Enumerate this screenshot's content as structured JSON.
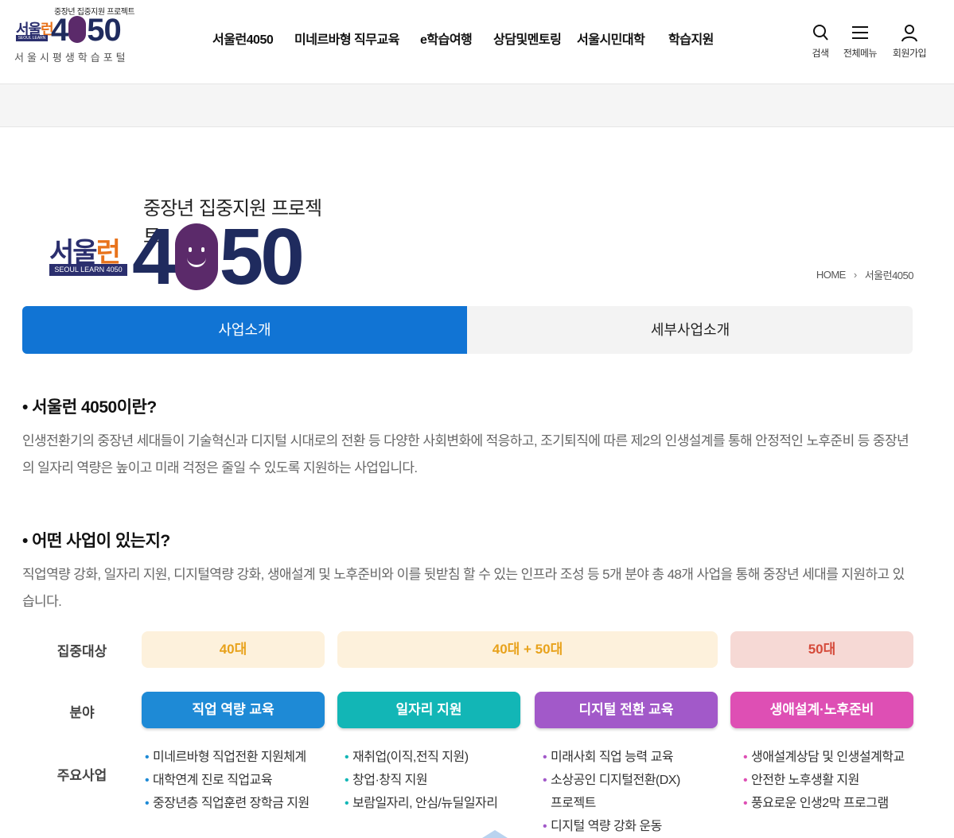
{
  "header": {
    "logo": {
      "tagline": "중장년 집중지원 프로젝트",
      "brand_ko_a": "서울",
      "brand_ko_b": "런",
      "brand_sub": "SEOUL LEARN 4050",
      "brand_num_a": "4",
      "brand_num_b": "50",
      "portal": "서울시평생학습포털"
    },
    "nav": [
      "서울런4050",
      "미네르바형 직무교육",
      "e학습여행",
      "상담및멘토링",
      "서울시민대학",
      "학습지원"
    ],
    "utils": {
      "search": "검색",
      "menu": "전체메뉴",
      "join": "회원가입"
    }
  },
  "hero": {
    "tagline": "중장년 집중지원 프로젝트",
    "brand_ko_a": "서울",
    "brand_ko_b": "런",
    "brand_sub": "SEOUL LEARN 4050",
    "num_a": "4",
    "num_b": "50"
  },
  "breadcrumb": {
    "home": "HOME",
    "current": "서울런4050"
  },
  "tabs": [
    {
      "label": "사업소개",
      "active": true
    },
    {
      "label": "세부사업소개",
      "active": false
    }
  ],
  "section1": {
    "title": "• 서울런 4050이란?",
    "body": "인생전환기의 중장년 세대들이 기술혁신과 디지털 시대로의 전환 등 다양한 사회변화에 적응하고, 조기퇴직에 따른 제2의 인생설계를 통해 안정적인 노후준비 등 중장년의 일자리 역량은 높이고 미래 걱정은 줄일 수 있도록 지원하는 사업입니다."
  },
  "section2": {
    "title": "• 어떤 사업이 있는지?",
    "body": "직업역량 강화, 일자리 지원, 디지털역량 강화, 생애설계 및 노후준비와 이를 뒷받침 할 수 있는 인프라 조성 등 5개 분야 총 48개 사업을 통해 중장년 세대를 지원하고 있습니다."
  },
  "diagram": {
    "labels": {
      "target": "집중대상",
      "field": "분야",
      "main": "주요사업"
    },
    "targets": [
      "40대",
      "40대 + 50대",
      "50대"
    ],
    "fields": [
      {
        "label": "직업 역량 교육",
        "color": "#1e8ad6"
      },
      {
        "label": "일자리 지원",
        "color": "#12b6b6"
      },
      {
        "label": "디지털 전환 교육",
        "color": "#a259c9"
      },
      {
        "label": "생애설계·노후준비",
        "color": "#de4fb4"
      }
    ],
    "items": {
      "col1": [
        "미네르바형 직업전환 지원체계",
        "대학연계 진로 직업교육",
        "중장년층 직업훈련 장학금 지원"
      ],
      "col2": [
        "재취업(이직,전직 지원)",
        "창업·창직 지원",
        "보람일자리, 안심/뉴딜일자리"
      ],
      "col3a": "미래사회 직업 능력 교육",
      "col3b_1": "소상공인 디지털전환(DX)",
      "col3b_2": "프로젝트",
      "col3c": "디지털 역량 강화 운동",
      "col4": [
        "생애설계상담 및 인생설계학교",
        "안전한 노후생활 지원",
        "풍요로운 인생2막 프로그램"
      ]
    }
  },
  "colors": {
    "primary": "#1174d4",
    "brand_navy": "#1f2b5e",
    "brand_purple": "#5b2a6a",
    "brand_orange": "#e8731c"
  }
}
